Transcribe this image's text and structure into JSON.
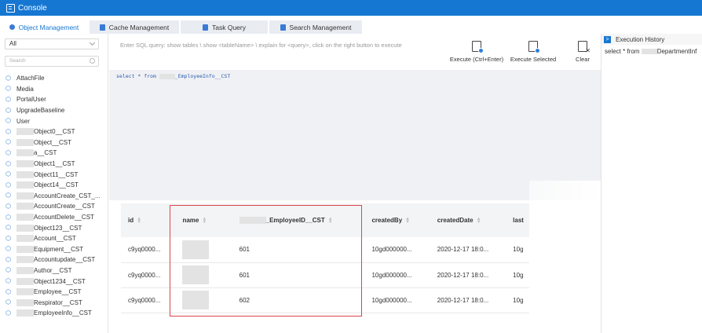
{
  "app": {
    "title": "Console"
  },
  "tabs": [
    {
      "label": "Object Management",
      "active": true
    },
    {
      "label": "Cache Management",
      "active": false
    },
    {
      "label": "Task Query",
      "active": false
    },
    {
      "label": "Search Management",
      "active": false
    }
  ],
  "sidebar": {
    "select_value": "All",
    "search_placeholder": "Search",
    "items": [
      {
        "label": "AttachFile",
        "blur": 0
      },
      {
        "label": "Media",
        "blur": 0
      },
      {
        "label": "PortalUser",
        "blur": 0
      },
      {
        "label": "UpgradeBaseline",
        "blur": 0
      },
      {
        "label": "User",
        "blur": 0
      },
      {
        "label": "Object0__CST",
        "blur": 22
      },
      {
        "label": "Object__CST",
        "blur": 22
      },
      {
        "label": "a__CST",
        "blur": 22
      },
      {
        "label": "Object1__CST",
        "blur": 22
      },
      {
        "label": "Object11__CST",
        "blur": 22
      },
      {
        "label": "Object14__CST",
        "blur": 22
      },
      {
        "label": "AccountCreate_CST_...",
        "blur": 22
      },
      {
        "label": "AccountCreate__CST",
        "blur": 22
      },
      {
        "label": "AccountDelete__CST",
        "blur": 22
      },
      {
        "label": "Object123__CST",
        "blur": 22
      },
      {
        "label": "Account__CST",
        "blur": 22
      },
      {
        "label": "Equipment__CST",
        "blur": 22
      },
      {
        "label": "Accountupdate__CST",
        "blur": 22
      },
      {
        "label": "Author__CST",
        "blur": 22
      },
      {
        "label": "Object1234__CST",
        "blur": 22
      },
      {
        "label": "Employee__CST",
        "blur": 22
      },
      {
        "label": "Respirator__CST",
        "blur": 22
      },
      {
        "label": "EmployeeInfo__CST",
        "blur": 22
      }
    ]
  },
  "editor": {
    "hint": "Enter SQL query: show tables \\ show <tableName> \\ explain for <query>,  click on the right button to execute",
    "query_prefix": "select * from ",
    "query_suffix": "_EmployeeInfo__CST"
  },
  "toolbar": {
    "execute_label": "Execute (Ctrl+Enter)",
    "execute_selected_label": "Execute Selected",
    "clear_label": "Clear"
  },
  "history": {
    "title": "Execution History",
    "items": [
      {
        "prefix": "select * from ",
        "suffix": "DepartmentInf"
      }
    ]
  },
  "table": {
    "columns": [
      "id",
      "name",
      "_EmployeeID__CST",
      "createdBy",
      "createdDate",
      "last"
    ],
    "rows": [
      [
        "c9yq0000...",
        "",
        "601",
        "10gd000000...",
        "2020-12-17 18:0...",
        "10g"
      ],
      [
        "c9yq0000...",
        "",
        "601",
        "10gd000000...",
        "2020-12-17 18:0...",
        "10g"
      ],
      [
        "c9yq0000...",
        "",
        "602",
        "10gd000000...",
        "2020-12-17 18:0...",
        "10g"
      ]
    ]
  },
  "colors": {
    "accent": "#1677d2",
    "highlight": "#d9464c"
  }
}
